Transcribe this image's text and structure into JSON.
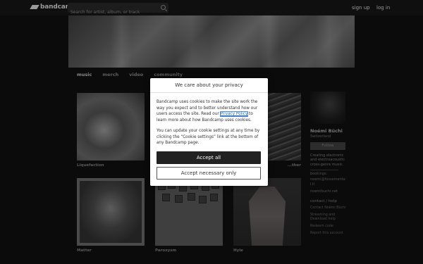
{
  "header": {
    "logo_text": "bandcamp",
    "search_placeholder": "Search for artist, album, or track",
    "signup": "sign up",
    "login": "log in"
  },
  "tabs": [
    {
      "label": "music",
      "active": true
    },
    {
      "label": "merch",
      "active": false
    },
    {
      "label": "video",
      "active": false
    },
    {
      "label": "community",
      "active": false
    }
  ],
  "albums": [
    {
      "title": "Liquefaction"
    },
    {
      "title": ""
    },
    {
      "title": "...ther"
    },
    {
      "title": "Matter"
    },
    {
      "title": "Paroxysm"
    },
    {
      "title": "Hyle"
    }
  ],
  "sidebar": {
    "artist_name": "Noémi Büchi",
    "location": "Switzerland",
    "follow": "Follow",
    "bio": "Creating electronic and electroacoustic cross-genre music.",
    "bookings_label": "bookings:",
    "bookings_value": "noemi@fossemental.it",
    "website": "noemibuchi.net",
    "contact": "contact / help",
    "links": [
      "Contact Noémi Büchi",
      "Streaming and Download help",
      "Redeem code",
      "Report this account"
    ]
  },
  "modal": {
    "title": "We care about your privacy",
    "para1_a": "Bandcamp uses cookies to make the site work the way you expect and to better understand how our users access the site. Read our ",
    "policy_link": "Privacy Policy",
    "para1_b": " to learn more about how Bandcamp uses cookies.",
    "para2": "You can update your cookie settings at any time by clicking the “Cookie settings” link at the bottom of any Bandcamp page.",
    "accept_all": "Accept all",
    "accept_necessary": "Accept necessary only"
  }
}
